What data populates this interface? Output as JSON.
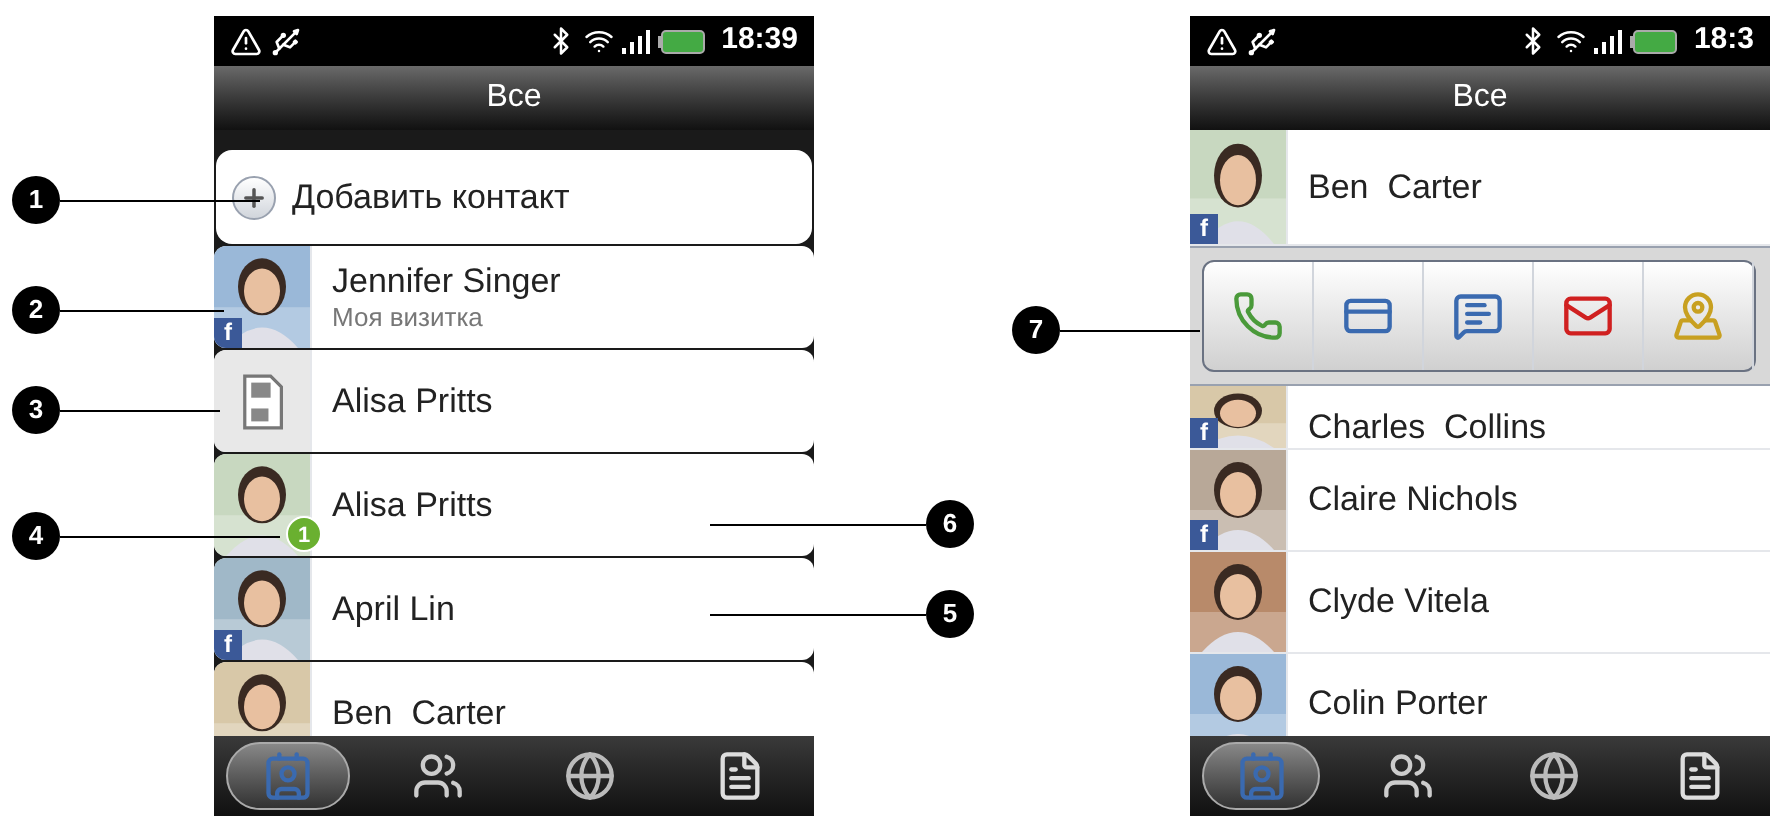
{
  "callouts": [
    {
      "number": "1"
    },
    {
      "number": "2"
    },
    {
      "number": "3"
    },
    {
      "number": "4"
    },
    {
      "number": "6"
    },
    {
      "number": "5"
    },
    {
      "number": "7"
    }
  ],
  "phones": [
    {
      "status_time": "18:39",
      "title": "Все",
      "cards": true,
      "rows": [
        {
          "kind": "action",
          "name": "Добавить контакт"
        },
        {
          "kind": "contact",
          "name": "Jennifer Singer",
          "subtitle": "Моя визитка",
          "badge": "f"
        },
        {
          "kind": "sim",
          "name": "Alisa Pritts"
        },
        {
          "kind": "contact",
          "name": "Alisa Pritts",
          "count": "1"
        },
        {
          "kind": "contact",
          "name": "April Lin",
          "badge": "f"
        },
        {
          "kind": "contact",
          "name": "Ben  Carter"
        }
      ],
      "tabs": [
        {
          "kind": "people",
          "selected": true
        },
        {
          "kind": "groups",
          "selected": false
        },
        {
          "kind": "online",
          "selected": false
        },
        {
          "kind": "calls",
          "selected": false
        }
      ]
    },
    {
      "status_time": "18:3",
      "title": "Все",
      "cards": false,
      "rows": [
        {
          "kind": "contact",
          "name": "Ben  Carter",
          "badge": "f"
        },
        {
          "kind": "popup",
          "actions": [
            {
              "kind": "call"
            },
            {
              "kind": "card"
            },
            {
              "kind": "message"
            },
            {
              "kind": "mail"
            },
            {
              "kind": "map"
            }
          ]
        },
        {
          "kind": "contact",
          "name": "Charles  Collins",
          "badge": "f"
        },
        {
          "kind": "contact",
          "name": "Claire Nichols",
          "badge": "f"
        },
        {
          "kind": "contact",
          "name": "Clyde Vitela"
        },
        {
          "kind": "contact",
          "name": "Colin Porter"
        }
      ],
      "tabs": [
        {
          "kind": "people",
          "selected": true
        },
        {
          "kind": "groups",
          "selected": false
        },
        {
          "kind": "online",
          "selected": false
        },
        {
          "kind": "calls",
          "selected": false
        }
      ]
    }
  ]
}
